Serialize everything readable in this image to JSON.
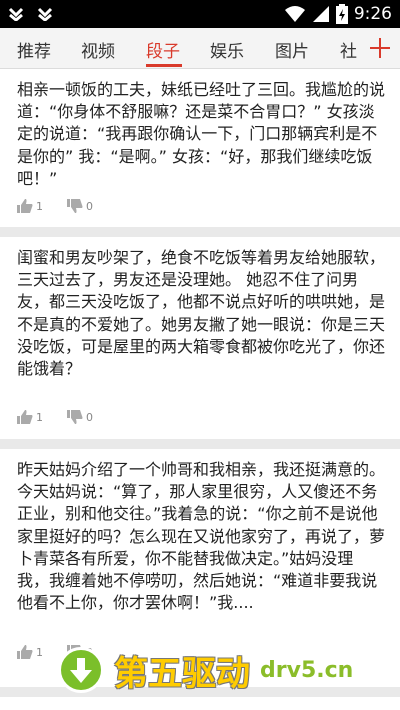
{
  "status": {
    "time": "9:26"
  },
  "tabs": [
    "推荐",
    "视频",
    "段子",
    "娱乐",
    "图片",
    "社"
  ],
  "active_tab": 2,
  "accent_color": "#d93a2b",
  "posts": [
    {
      "text": "相亲一顿饭的工夫，妹纸已经吐了三回。我尴尬的说道：“你身体不舒服嘛？还是菜不合胃口？” 女孩淡定的说道：“我再跟你确认一下，门口那辆宾利是不是你的” 我：“是啊。” 女孩：“好，那我们继续吃饭吧！”",
      "likes": "1",
      "dislikes": "0"
    },
    {
      "text": "闺蜜和男友吵架了，绝食不吃饭等着男友给她服软，三天过去了，男友还是没理她。 她忍不住了问男友，都三天没吃饭了，他都不说点好听的哄哄她，是不是真的不爱她了。她男友撇了她一眼说：你是三天没吃饭，可是屋里的两大箱零食都被你吃光了，你还能饿着？",
      "likes": "1",
      "dislikes": "0"
    },
    {
      "text": "昨天姑妈介绍了一个帅哥和我相亲，我还挺满意的。今天姑妈说：“算了，那人家里很穷，人又傻还不务正业，别和他交往。”我着急的说：“你之前不是说他家里挺好的吗？怎么现在又说他家穷了，再说了，萝卜青菜各有所爱，你不能替我做决定。”姑妈没理我，我缠着她不停唠叨，然后她说：“难道非要我说他看不上你，你才罢休啊！”我....",
      "likes": "1",
      "dislikes": "0"
    }
  ],
  "watermark": {
    "title": "第五驱动",
    "domain": "drv5.cn"
  }
}
